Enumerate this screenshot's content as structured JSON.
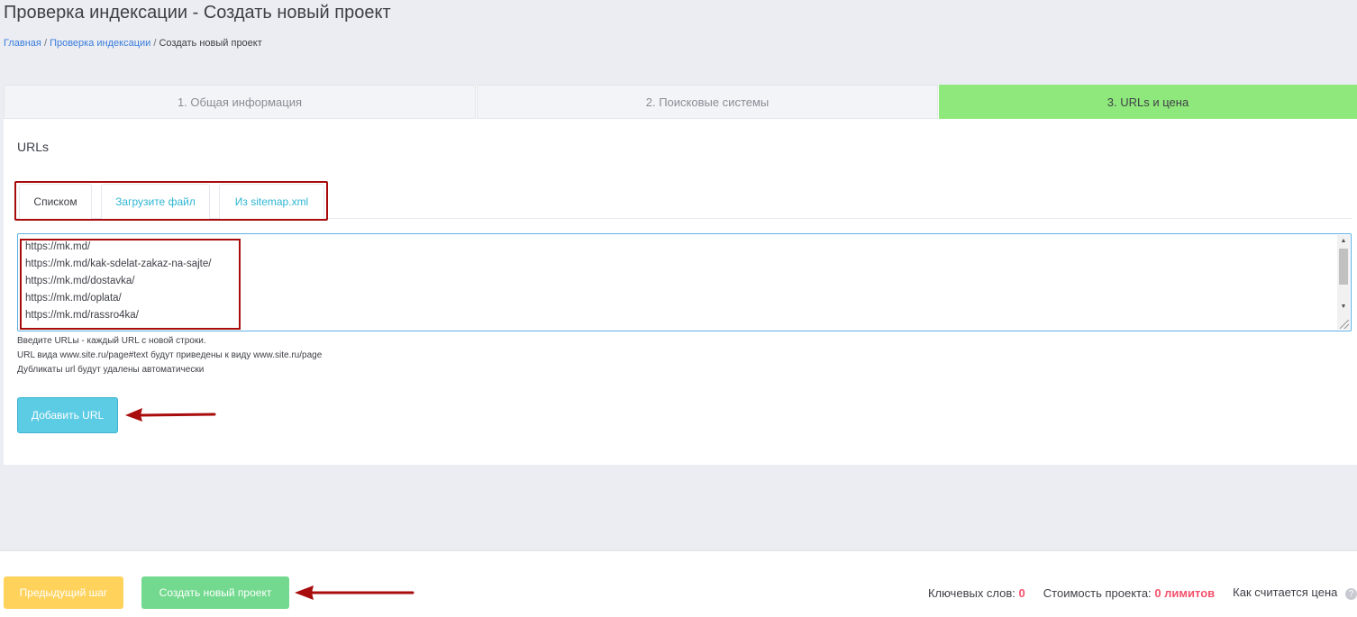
{
  "header": {
    "title": "Проверка индексации - Создать новый проект",
    "breadcrumb": {
      "home": "Главная",
      "separator": "/",
      "section": "Проверка индексации",
      "current": "Создать новый проект"
    }
  },
  "steps": [
    {
      "label": "1. Общая информация",
      "active": false
    },
    {
      "label": "2. Поисковые системы",
      "active": false
    },
    {
      "label": "3. URLs и цена",
      "active": true
    }
  ],
  "urls_section": {
    "label": "URLs",
    "tabs": [
      {
        "label": "Списком",
        "active": true
      },
      {
        "label": "Загрузите файл",
        "active": false
      },
      {
        "label": "Из sitemap.xml",
        "active": false
      }
    ],
    "textarea_lines": [
      "https://mk.md/",
      "https://mk.md/kak-sdelat-zakaz-na-sajte/",
      "https://mk.md/dostavka/",
      "https://mk.md/oplata/",
      "https://mk.md/rassro4ka/"
    ],
    "hints": [
      "Введите URLы - каждый URL с новой строки.",
      "URL вида www.site.ru/page#text будут приведены к виду www.site.ru/page",
      "Дубликаты url будут удалены автоматически"
    ],
    "add_button": "Добавить URL"
  },
  "footer": {
    "prev_button": "Предыдущий шаг",
    "create_button": "Создать новый проект",
    "keywords_label": "Ключевых слов:",
    "keywords_value": "0",
    "cost_label": "Стоимость проекта:",
    "cost_value": "0 лимитов",
    "price_info": "Как считается цена"
  },
  "colors": {
    "active_step": "#8fe87c",
    "accent_link": "#2fb6d1",
    "add_button": "#5ccbe4",
    "prev_button": "#ffd25c",
    "create_button": "#72d98e",
    "highlight": "#a80c0c",
    "stat_value": "#f4516c"
  }
}
